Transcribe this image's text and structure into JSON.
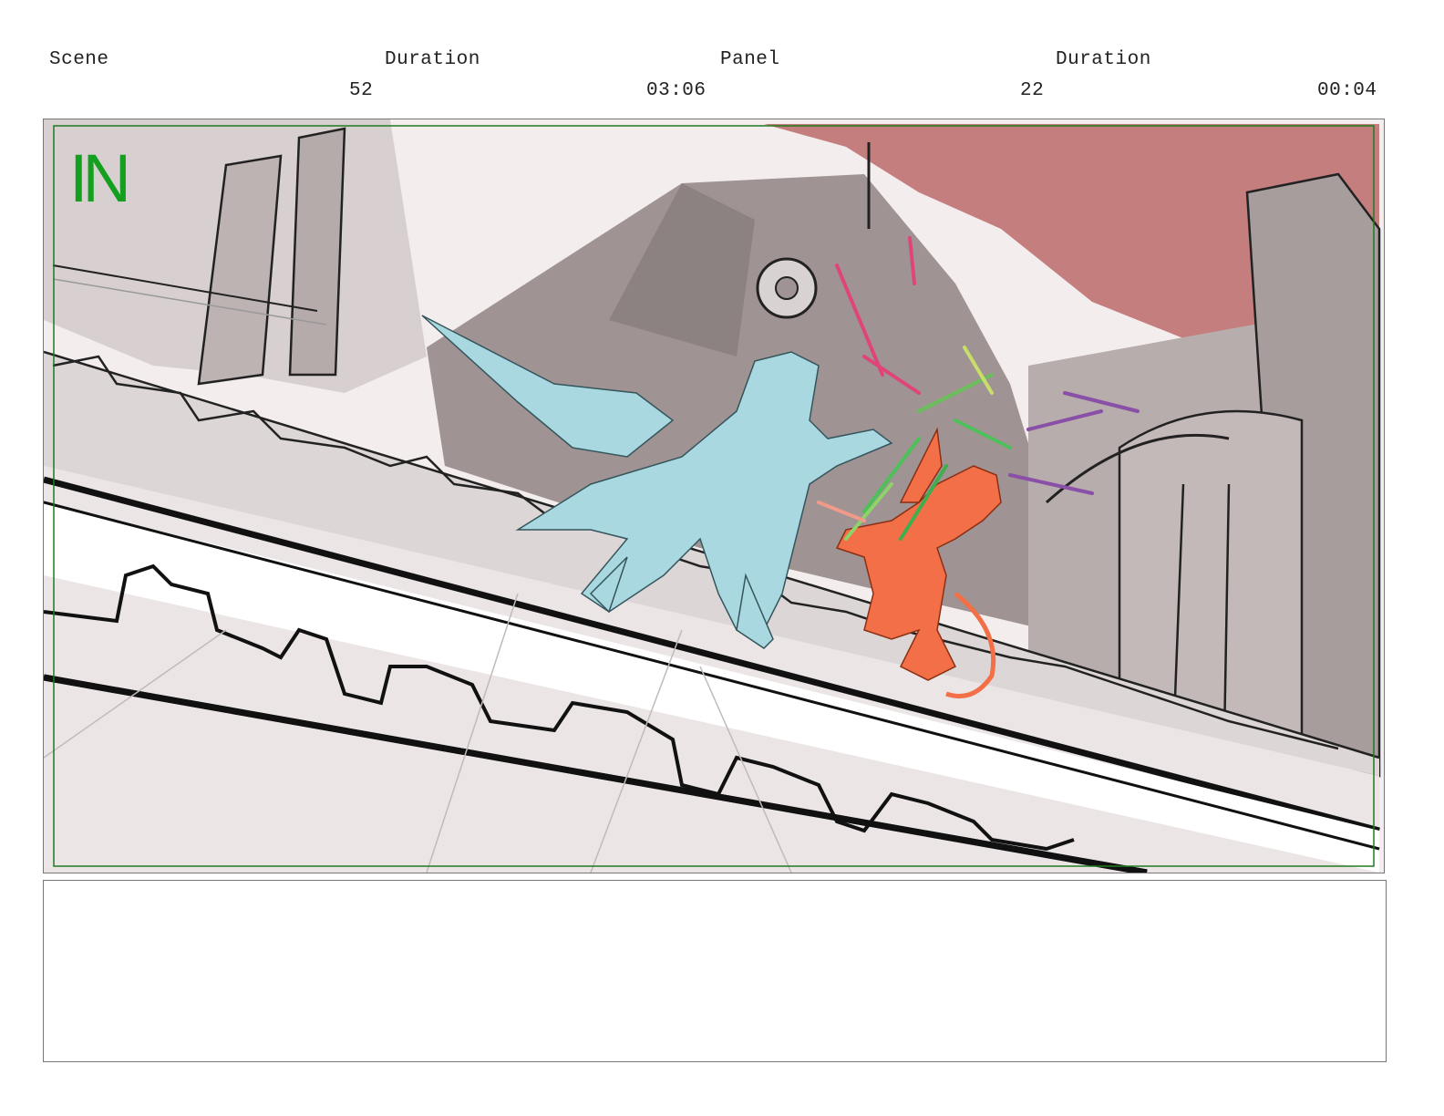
{
  "header": {
    "scene_label": "Scene",
    "scene_duration_label": "Duration",
    "panel_label": "Panel",
    "panel_duration_label": "Duration",
    "scene_number": "52",
    "scene_duration": "03:06",
    "panel_number": "22",
    "panel_duration": "00:04"
  },
  "panel": {
    "transition_marker": "IN",
    "marker_color": "#14a01e",
    "sky_color": "#c47e7e",
    "character_left_color": "#a9d8e0",
    "character_right_color": "#f26f47"
  },
  "notes": {
    "text": ""
  }
}
